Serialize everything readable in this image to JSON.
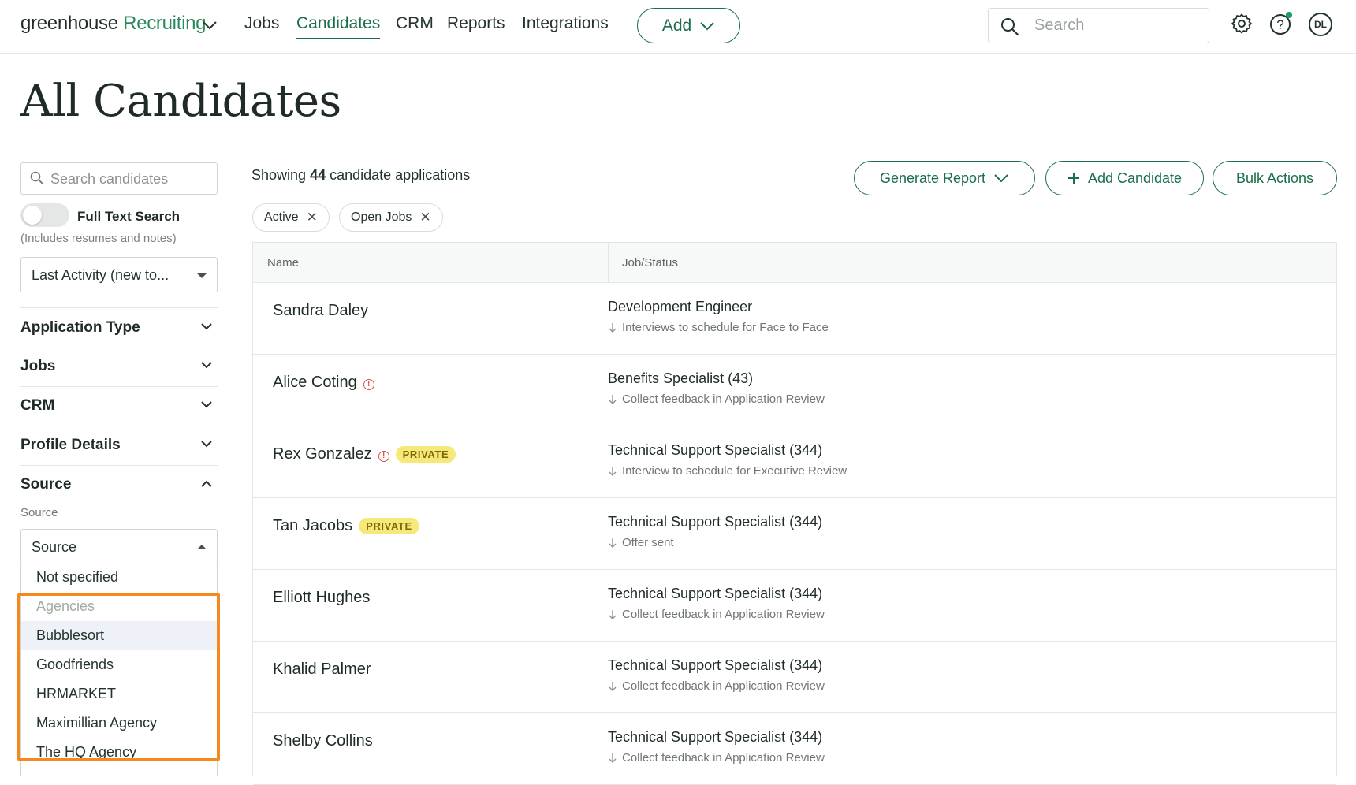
{
  "topnav": {
    "logo_main": "greenhouse",
    "logo_accent": "Recruiting",
    "items": [
      {
        "label": "Jobs"
      },
      {
        "label": "Candidates",
        "active": true
      },
      {
        "label": "CRM"
      },
      {
        "label": "Reports"
      },
      {
        "label": "Integrations"
      }
    ],
    "add_label": "Add",
    "search_placeholder": "Search",
    "avatar_initials": "DL",
    "accent_color": "#1b6e4b"
  },
  "page": {
    "title": "All Candidates"
  },
  "sidebar": {
    "search_placeholder": "Search candidates",
    "full_text_label": "Full Text Search",
    "full_text_hint": "(Includes resumes and notes)",
    "full_text_enabled": false,
    "sort_value": "Last Activity (new to...",
    "filters": [
      {
        "label": "Application Type",
        "expanded": false
      },
      {
        "label": "Jobs",
        "expanded": false
      },
      {
        "label": "CRM",
        "expanded": false
      },
      {
        "label": "Profile Details",
        "expanded": false
      },
      {
        "label": "Source",
        "expanded": true
      }
    ],
    "source": {
      "field_label": "Source",
      "select_value": "Source",
      "options": [
        {
          "label": "Not specified",
          "type": "option"
        },
        {
          "label": "Agencies",
          "type": "group"
        },
        {
          "label": "Bubblesort",
          "type": "option",
          "highlighted": true
        },
        {
          "label": "Goodfriends",
          "type": "option"
        },
        {
          "label": "HRMARKET",
          "type": "option"
        },
        {
          "label": "Maximillian Agency",
          "type": "option"
        },
        {
          "label": "The HQ Agency",
          "type": "option"
        }
      ],
      "highlight_color": "#f5891f"
    }
  },
  "main": {
    "showing_prefix": "Showing",
    "showing_count": "44",
    "showing_suffix": "candidate applications",
    "actions": {
      "generate_report": "Generate Report",
      "add_candidate": "Add Candidate",
      "bulk_actions": "Bulk Actions"
    },
    "chips": [
      "Active",
      "Open Jobs"
    ],
    "columns": [
      "Name",
      "Job/Status"
    ],
    "rows": [
      {
        "name": "Sandra Daley",
        "warn": false,
        "private": "",
        "job": "Development Engineer",
        "status": "Interviews to schedule for Face to Face"
      },
      {
        "name": "Alice Coting",
        "warn": true,
        "private": "",
        "job": "Benefits Specialist (43)",
        "status": "Collect feedback in Application Review"
      },
      {
        "name": "Rex Gonzalez",
        "warn": true,
        "private": "PRIVATE",
        "job": "Technical Support Specialist (344)",
        "status": "Interview to schedule for Executive Review"
      },
      {
        "name": "Tan Jacobs",
        "warn": false,
        "private": "PRIVATE",
        "job": "Technical Support Specialist (344)",
        "status": "Offer sent"
      },
      {
        "name": "Elliott Hughes",
        "warn": false,
        "private": "",
        "job": "Technical Support Specialist (344)",
        "status": "Collect feedback in Application Review"
      },
      {
        "name": "Khalid Palmer",
        "warn": false,
        "private": "",
        "job": "Technical Support Specialist (344)",
        "status": "Collect feedback in Application Review"
      },
      {
        "name": "Shelby Collins",
        "warn": false,
        "private": "",
        "job": "Technical Support Specialist (344)",
        "status": "Collect feedback in Application Review"
      }
    ]
  }
}
